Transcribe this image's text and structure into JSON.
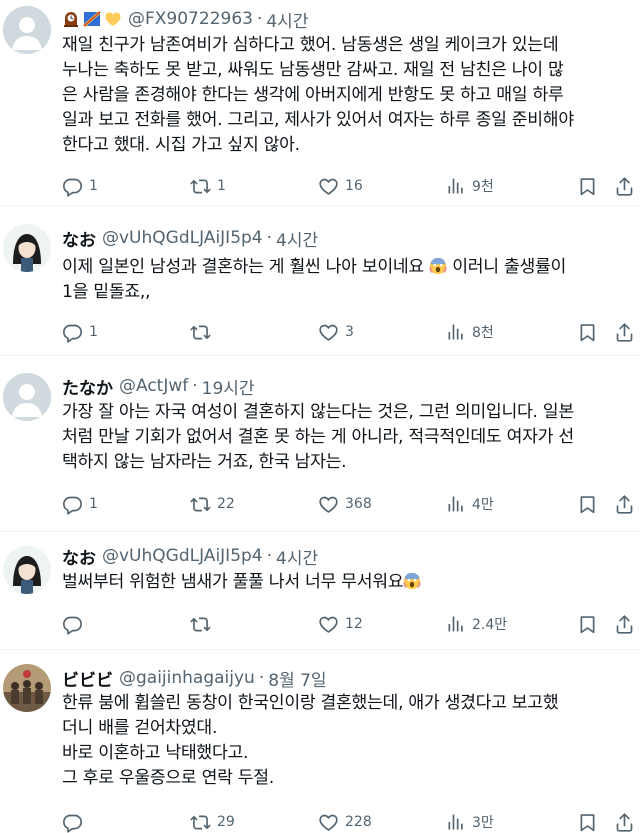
{
  "tweets": [
    {
      "name": "",
      "handle": "@FX90722963",
      "time": "4시간",
      "text_lines": [
        "재일 친구가 남존여비가 심하다고 했어. 남동생은 생일 케이크가 있는데",
        "누나는 축하도 못 받고, 싸워도 남동생만 감싸고. 재일 전 남친은 나이 많",
        "은 사람을 존경해야 한다는 생각에 아버지에게 반항도 못 하고 매일 하루",
        "일과 보고 전화를 했어. 그리고, 제사가 있어서 여자는 하루 종일 준비해야",
        "한다고 했대. 시집 가고 싶지 않아."
      ],
      "replies": "1",
      "retweets": "1",
      "likes": "16",
      "views": "9천"
    },
    {
      "name": "なお",
      "handle": "@vUhQGdLJAiJI5p4",
      "time": "4시간",
      "text_lines": [
        "이제 일본인 남성과 결혼하는 게 훨씬 나아 보이네요",
        "1을 밑돌죠,,"
      ],
      "text_after_emoji": " 이러니 출생률이",
      "replies": "1",
      "retweets": "",
      "likes": "3",
      "views": "8천"
    },
    {
      "name": "たなか",
      "handle": "@ActJwf",
      "time": "19시간",
      "text_lines": [
        "가장 잘 아는 자국 여성이 결혼하지 않는다는 것은, 그런 의미입니다. 일본",
        "처럼 만날 기회가 없어서 결혼 못 하는 게 아니라, 적극적인데도 여자가 선",
        "택하지 않는 남자라는 거죠, 한국 남자는."
      ],
      "replies": "1",
      "retweets": "22",
      "likes": "368",
      "views": "4만"
    },
    {
      "name": "なお",
      "handle": "@vUhQGdLJAiJI5p4",
      "time": "4시간",
      "text_lines": [
        "벌써부터 위험한 냄새가 풀풀 나서 너무 무서워요"
      ],
      "replies": "",
      "retweets": "",
      "likes": "12",
      "views": "2.4만"
    },
    {
      "name": "ビビビ",
      "handle": "@gaijinhagaijyu",
      "time": "8월 7일",
      "text_lines": [
        "한류 붐에 휩쓸린 동창이 한국인이랑 결혼했는데, 애가 생겼다고 보고했",
        "더니 배를 걷어차였대.",
        "바로 이혼하고 낙태했다고.",
        "그 후로 우울증으로 연락 두절."
      ],
      "replies": "",
      "retweets": "29",
      "likes": "228",
      "views": "3만"
    }
  ],
  "icons": {
    "reply": "reply-icon",
    "retweet": "retweet-icon",
    "like": "heart-icon",
    "views": "views-icon",
    "bookmark": "bookmark-icon",
    "share": "share-icon"
  },
  "colors": {
    "text": "#0f1419",
    "muted": "#536471",
    "divider": "#eff3f4",
    "avatar_default": "#cfd9de"
  }
}
